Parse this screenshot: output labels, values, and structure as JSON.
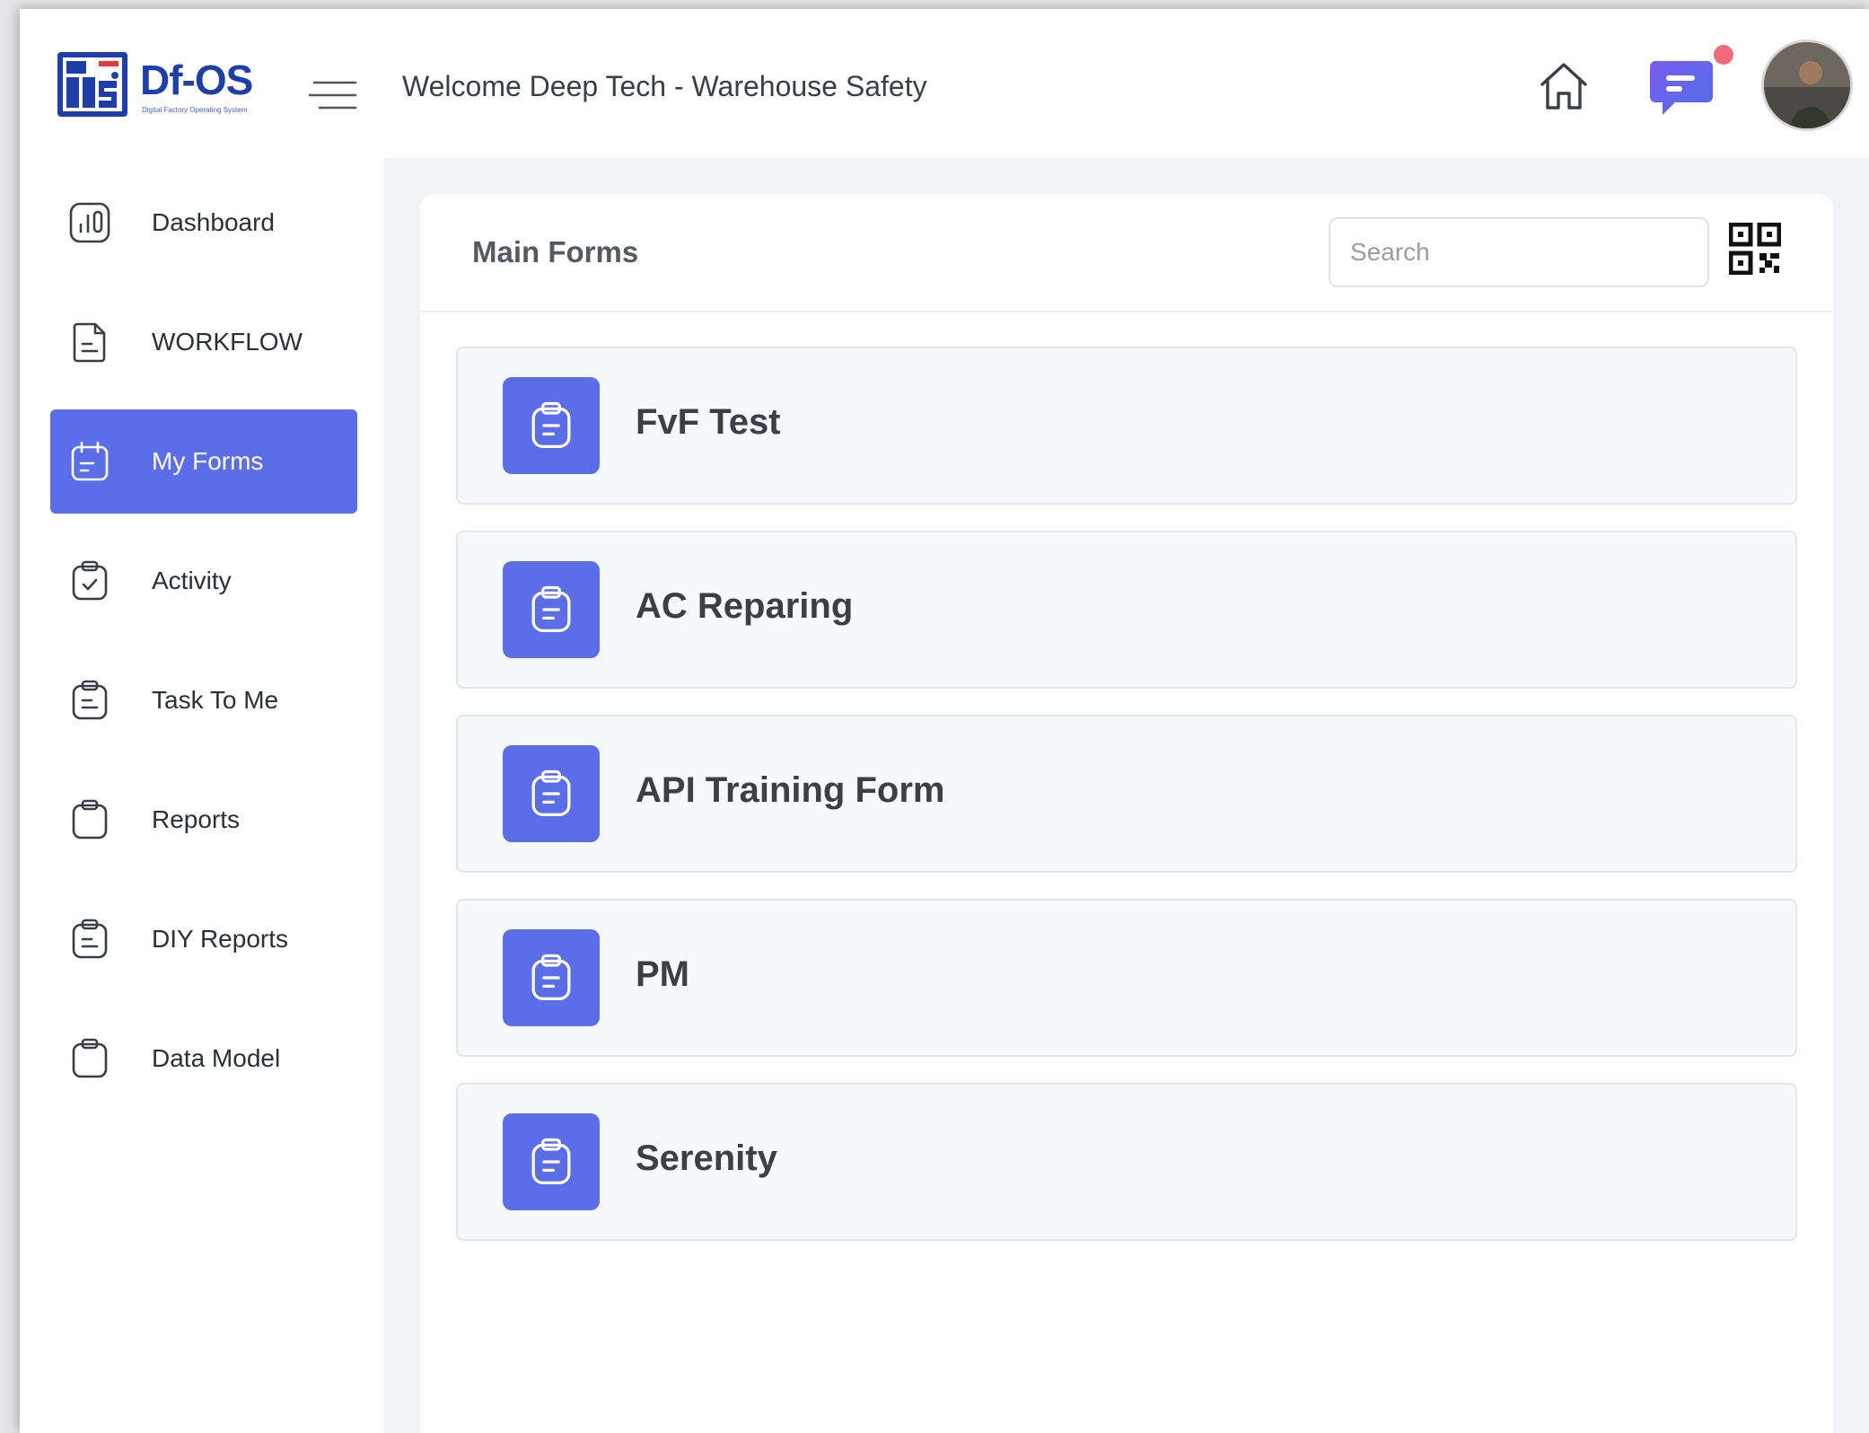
{
  "app": {
    "logo_text": "Df-OS",
    "logo_subtitle": "Digital Factory Operating System",
    "accent_color": "#5b6ee8"
  },
  "header": {
    "welcome": "Welcome Deep Tech - Warehouse Safety",
    "icons": [
      "home-icon",
      "chat-icon",
      "avatar"
    ],
    "notification_dot_color": "#f06b7b"
  },
  "sidebar": {
    "items": [
      {
        "label": "Dashboard",
        "icon": "chart-icon",
        "active": false
      },
      {
        "label": "WORKFLOW",
        "icon": "document-icon",
        "active": false
      },
      {
        "label": "My Forms",
        "icon": "calendar-form-icon",
        "active": true
      },
      {
        "label": "Activity",
        "icon": "clipboard-check-icon",
        "active": false
      },
      {
        "label": "Task To Me",
        "icon": "clipboard-list-icon",
        "active": false
      },
      {
        "label": "Reports",
        "icon": "clipboard-icon",
        "active": false
      },
      {
        "label": "DIY Reports",
        "icon": "clipboard-list-icon",
        "active": false
      },
      {
        "label": "Data Model",
        "icon": "clipboard-icon",
        "active": false
      }
    ]
  },
  "main": {
    "title": "Main Forms",
    "search_placeholder": "Search",
    "forms": [
      {
        "label": "FvF Test"
      },
      {
        "label": "AC Reparing"
      },
      {
        "label": "API Training Form"
      },
      {
        "label": "PM"
      },
      {
        "label": "Serenity"
      }
    ]
  }
}
